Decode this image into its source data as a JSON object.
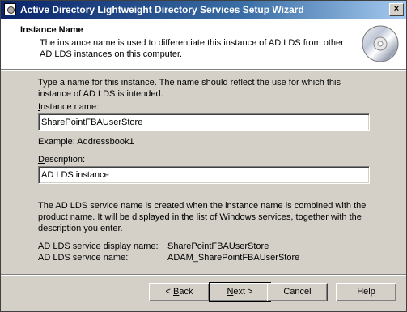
{
  "window": {
    "title": "Active Directory Lightweight Directory Services Setup Wizard",
    "close_glyph": "×"
  },
  "header": {
    "title": "Instance Name",
    "subtitle": "The instance name is used to differentiate this instance of AD LDS from other AD LDS instances on this computer.",
    "icon": "cd-disc-icon"
  },
  "form": {
    "intro": "Type a name for this instance. The name should reflect the use for which this instance of AD LDS is intended.",
    "instance_name_label_hotkey": "I",
    "instance_name_label_rest": "nstance name:",
    "instance_name_value": "SharePointFBAUserStore",
    "example": "Example: Addressbook1",
    "description_label_hotkey": "D",
    "description_label_rest": "escription:",
    "description_value": "AD LDS instance"
  },
  "service_info": {
    "note": "The AD LDS service name is created when the instance name is combined with the product name. It will be displayed in the list of Windows services, together with the description you enter.",
    "display_name_label": "AD LDS service display name:",
    "display_name_value": "SharePointFBAUserStore",
    "service_name_label": "AD LDS service name:",
    "service_name_value": "ADAM_SharePointFBAUserStore"
  },
  "buttons": {
    "back_prefix": "< ",
    "back_hotkey": "B",
    "back_rest": "ack",
    "next_hotkey": "N",
    "next_rest": "ext >",
    "cancel": "Cancel",
    "help": "Help"
  }
}
